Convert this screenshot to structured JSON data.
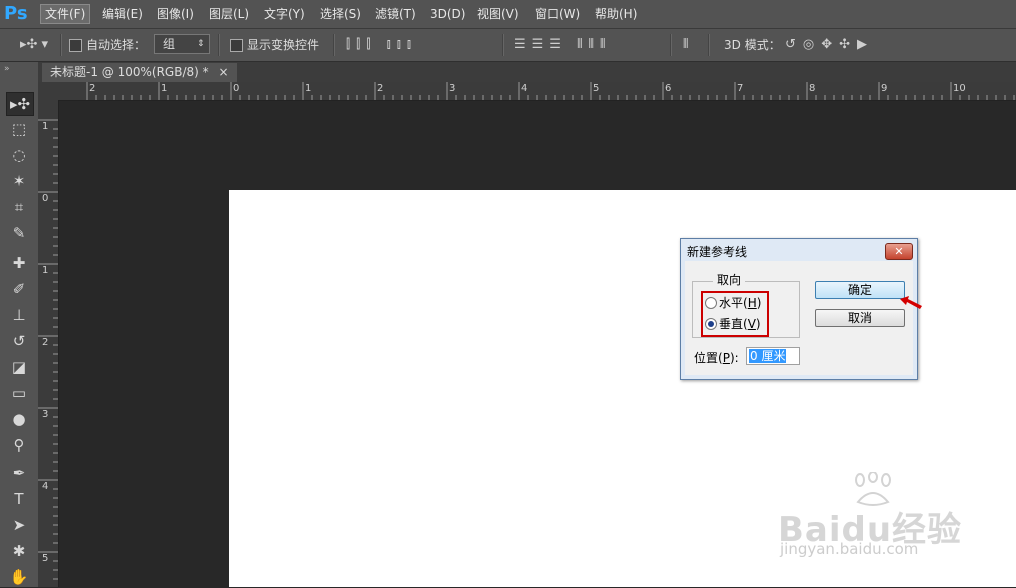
{
  "app": {
    "logo": "Ps"
  },
  "menu": {
    "items": [
      "文件(F)",
      "编辑(E)",
      "图像(I)",
      "图层(L)",
      "文字(Y)",
      "选择(S)",
      "滤镜(T)",
      "3D(D)",
      "视图(V)",
      "窗口(W)",
      "帮助(H)"
    ],
    "active_index": 0
  },
  "options_bar": {
    "auto_select_label": "自动选择：",
    "auto_select_value": "组",
    "show_transform_label": "显示变换控件",
    "mode_3d_label": "3D 模式："
  },
  "document": {
    "tab_title": "未标题-1 @ 100%(RGB/8) *",
    "tab_close": "×"
  },
  "ruler": {
    "horizontal_labels": [
      "2",
      "1",
      "0",
      "1",
      "2",
      "3",
      "4",
      "5",
      "6",
      "7",
      "8",
      "9",
      "10"
    ],
    "vertical_labels": [
      "1",
      "0",
      "1",
      "2",
      "3",
      "4",
      "5"
    ]
  },
  "dialog": {
    "title": "新建参考线",
    "close_label": "✕",
    "orientation_label": "取向",
    "horizontal_option": "水平(H)",
    "horizontal_text": "水平(",
    "horizontal_key": "H",
    "vertical_text": "垂直(",
    "vertical_key": "V",
    "selected_orientation": "vertical",
    "ok_label": "确定",
    "cancel_label": "取消",
    "position_text": "位置(",
    "position_key": "P",
    "position_suffix": "):",
    "position_value": "0 厘米"
  },
  "watermark": {
    "brand": "Baidu经验",
    "url": "jingyan.baidu.com"
  },
  "colors": {
    "accent": "#31a8ff",
    "highlight": "#cc0000",
    "canvas": "#ffffff",
    "workspace": "#282828"
  }
}
